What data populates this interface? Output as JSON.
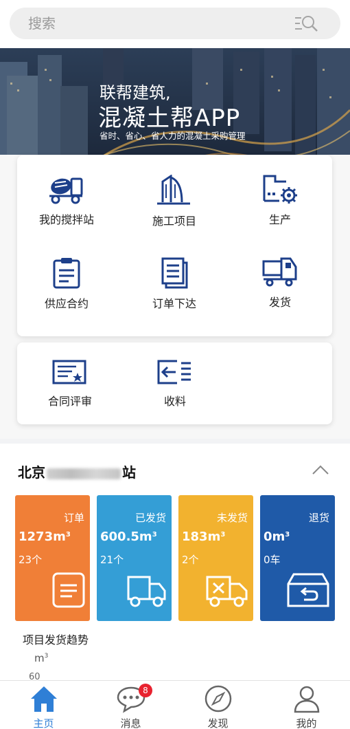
{
  "search": {
    "placeholder": "搜索"
  },
  "banner": {
    "line1": "联帮建筑,",
    "line2": "混凝土帮APP",
    "line3": "省时、省心、省人力的混凝土采购管理"
  },
  "functions": [
    {
      "label": "我的搅拌站",
      "icon": "mixer-truck-icon"
    },
    {
      "label": "施工项目",
      "icon": "building-icon"
    },
    {
      "label": "生产",
      "icon": "factory-gear-icon"
    },
    {
      "label": "供应合约",
      "icon": "clipboard-icon"
    },
    {
      "label": "订单下达",
      "icon": "document-list-icon"
    },
    {
      "label": "发货",
      "icon": "delivery-truck-icon"
    },
    {
      "label": "合同评审",
      "icon": "certificate-icon"
    },
    {
      "label": "收料",
      "icon": "receive-arrow-icon"
    }
  ],
  "station": {
    "prefix": "北京",
    "suffix": "站"
  },
  "stats": [
    {
      "label": "订单",
      "amount": "1273m",
      "unit_sup": "3",
      "count": "23个",
      "color": "#f07f37",
      "icon": "order-doc-icon"
    },
    {
      "label": "已发货",
      "amount": "600.5m",
      "unit_sup": "3",
      "count": "21个",
      "color": "#349ed6",
      "icon": "truck-icon"
    },
    {
      "label": "未发货",
      "amount": "183m",
      "unit_sup": "3",
      "count": "2个",
      "color": "#f2b22f",
      "icon": "truck-x-icon"
    },
    {
      "label": "退货",
      "amount": "0m",
      "unit_sup": "3",
      "count": "0车",
      "color": "#1f5aa8",
      "icon": "return-box-icon"
    }
  ],
  "trend": {
    "title": "项目发货趋势",
    "unit": "m",
    "unit_sup": "3",
    "tick_top": "60"
  },
  "nav": [
    {
      "label": "主页",
      "icon": "home-icon",
      "active": true
    },
    {
      "label": "消息",
      "icon": "message-icon",
      "badge": "8"
    },
    {
      "label": "发现",
      "icon": "compass-icon"
    },
    {
      "label": "我的",
      "icon": "user-icon"
    }
  ],
  "colors": {
    "primary": "#1d3f8a",
    "active_nav": "#2f7fd6",
    "badge": "#e8222f"
  }
}
